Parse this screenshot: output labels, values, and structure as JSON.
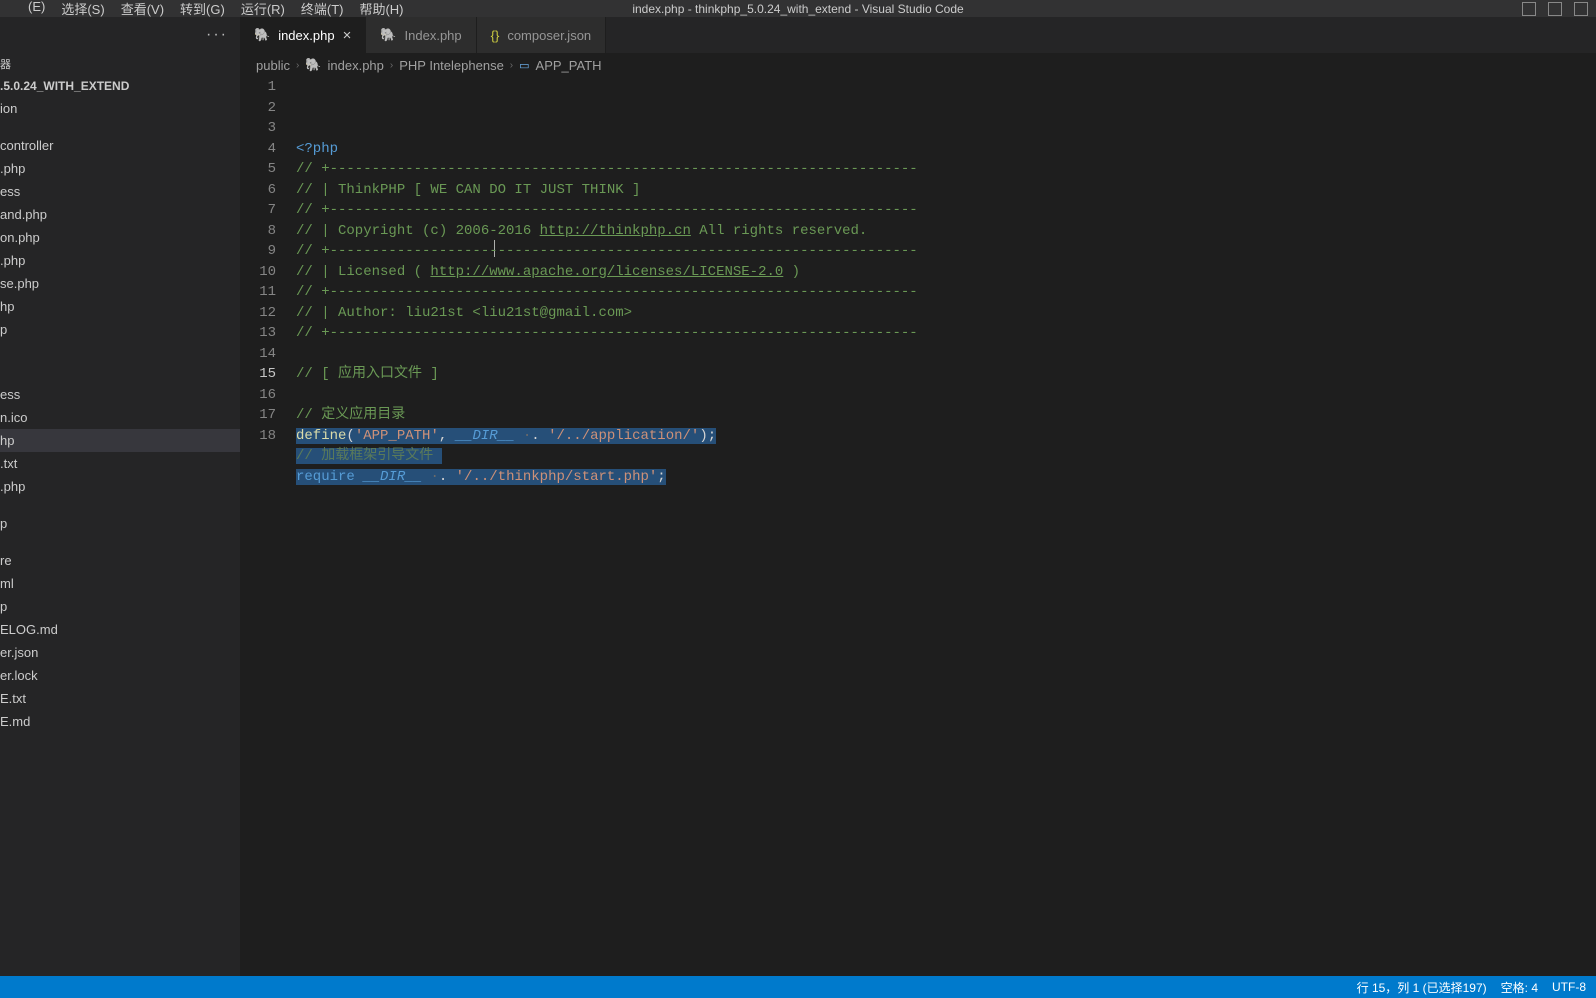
{
  "titlebar": {
    "menu": [
      "(E)",
      "选择(S)",
      "查看(V)",
      "转到(G)",
      "运行(R)",
      "终端(T)",
      "帮助(H)"
    ],
    "title": "index.php - thinkphp_5.0.24_with_extend - Visual Studio Code"
  },
  "sidebar": {
    "panel_label": "器",
    "project": ".5.0.24_WITH_EXTEND",
    "items": [
      {
        "label": "ion",
        "indent": 0
      },
      {
        "label": "",
        "spacer": true
      },
      {
        "label": "controller",
        "indent": 1
      },
      {
        "label": ".php",
        "indent": 0
      },
      {
        "label": "ess",
        "indent": 0
      },
      {
        "label": "and.php",
        "indent": 0
      },
      {
        "label": "on.php",
        "indent": 0
      },
      {
        "label": ".php",
        "indent": 0
      },
      {
        "label": "se.php",
        "indent": 0
      },
      {
        "label": "hp",
        "indent": 0
      },
      {
        "label": "p",
        "indent": 0
      },
      {
        "label": "",
        "spacer": true
      },
      {
        "label": "",
        "spacer": true
      },
      {
        "label": "",
        "spacer": true
      },
      {
        "label": "ess",
        "indent": 0
      },
      {
        "label": "n.ico",
        "indent": 0
      },
      {
        "label": "hp",
        "indent": 0,
        "active": true
      },
      {
        "label": ".txt",
        "indent": 0
      },
      {
        "label": ".php",
        "indent": 0
      },
      {
        "label": "",
        "spacer": true
      },
      {
        "label": "p",
        "indent": 0
      },
      {
        "label": "",
        "spacer": true
      },
      {
        "label": "re",
        "indent": 0
      },
      {
        "label": "ml",
        "indent": 0
      },
      {
        "label": "p",
        "indent": 0
      },
      {
        "label": "ELOG.md",
        "indent": 0
      },
      {
        "label": "er.json",
        "indent": 0
      },
      {
        "label": "er.lock",
        "indent": 0
      },
      {
        "label": "E.txt",
        "indent": 0
      },
      {
        "label": "E.md",
        "indent": 0
      }
    ]
  },
  "tabs": [
    {
      "icon": "php",
      "label": "index.php",
      "active": true,
      "close": true
    },
    {
      "icon": "php",
      "label": "Index.php",
      "active": false
    },
    {
      "icon": "json",
      "label": "composer.json",
      "active": false
    }
  ],
  "breadcrumb": {
    "parts": [
      "public",
      "index.php",
      "PHP Intelephense",
      "APP_PATH"
    ]
  },
  "code": {
    "lines": [
      {
        "n": 1,
        "seg": [
          {
            "t": "<?php",
            "c": "tk-tag"
          }
        ]
      },
      {
        "n": 2,
        "seg": [
          {
            "t": "// +----------------------------------------------------------------------",
            "c": "tk-comment"
          }
        ]
      },
      {
        "n": 3,
        "seg": [
          {
            "t": "// | ThinkPHP [ WE CAN DO IT JUST THINK ]",
            "c": "tk-comment"
          }
        ]
      },
      {
        "n": 4,
        "seg": [
          {
            "t": "// +----------------------------------------------------------------------",
            "c": "tk-comment"
          }
        ]
      },
      {
        "n": 5,
        "seg": [
          {
            "t": "// | Copyright (c) 2006-2016 ",
            "c": "tk-comment"
          },
          {
            "t": "http://thinkphp.cn",
            "c": "tk-link"
          },
          {
            "t": " All rights reserved.",
            "c": "tk-comment"
          }
        ]
      },
      {
        "n": 6,
        "seg": [
          {
            "t": "// +----------------------------------------------------------------------",
            "c": "tk-comment"
          }
        ]
      },
      {
        "n": 7,
        "seg": [
          {
            "t": "// | Licensed ( ",
            "c": "tk-comment"
          },
          {
            "t": "http://www.apache.org/licenses/LICENSE-2.0",
            "c": "tk-link"
          },
          {
            "t": " )",
            "c": "tk-comment"
          }
        ]
      },
      {
        "n": 8,
        "seg": [
          {
            "t": "// +----------------------------------------------------------------------",
            "c": "tk-comment"
          }
        ]
      },
      {
        "n": 9,
        "seg": [
          {
            "t": "// | Author: liu21st <liu21st@gmail.com>",
            "c": "tk-comment"
          }
        ]
      },
      {
        "n": 10,
        "seg": [
          {
            "t": "// +----------------------------------------------------------------------",
            "c": "tk-comment"
          }
        ]
      },
      {
        "n": 11,
        "seg": []
      },
      {
        "n": 12,
        "seg": [
          {
            "t": "// [ 应用入口文件 ]",
            "c": "tk-comment"
          }
        ]
      },
      {
        "n": 13,
        "seg": []
      },
      {
        "n": 14,
        "seg": [
          {
            "t": "// 定义应用目录",
            "c": "tk-comment"
          }
        ]
      },
      {
        "n": 15,
        "active": true,
        "seg": [
          {
            "t": "define",
            "c": "tk-fn sel"
          },
          {
            "t": "(",
            "c": "sel"
          },
          {
            "t": "'APP_PATH'",
            "c": "tk-str sel"
          },
          {
            "t": ",",
            "c": "sel"
          },
          {
            "t": " ",
            "c": "sel"
          },
          {
            "t": "__DIR__",
            "c": "tk-const sel"
          },
          {
            "t": " ",
            "c": "sel"
          },
          {
            "t": "·",
            "c": "tk-dim sel"
          },
          {
            "t": ".",
            "c": "sel"
          },
          {
            "t": " ",
            "c": "sel"
          },
          {
            "t": "'/../application/'",
            "c": "tk-str sel"
          },
          {
            "t": ");",
            "c": "sel"
          }
        ]
      },
      {
        "n": 16,
        "seg": [
          {
            "t": "// 加载框架引导文件 ",
            "c": "tk-comment sel dim"
          }
        ]
      },
      {
        "n": 17,
        "seg": [
          {
            "t": "require",
            "c": "tk-tag sel"
          },
          {
            "t": " ",
            "c": "sel"
          },
          {
            "t": "__DIR__",
            "c": "tk-const sel"
          },
          {
            "t": " ",
            "c": "sel"
          },
          {
            "t": "·",
            "c": "tk-dim sel"
          },
          {
            "t": ".",
            "c": "sel"
          },
          {
            "t": " ",
            "c": "sel"
          },
          {
            "t": "'/../thinkphp/start.php'",
            "c": "tk-str sel"
          },
          {
            "t": ";",
            "c": "sel"
          }
        ]
      },
      {
        "n": 18,
        "seg": []
      }
    ]
  },
  "status": {
    "items": [
      "行 15，列 1 (已选择197)",
      "空格: 4",
      "UTF-8"
    ]
  }
}
